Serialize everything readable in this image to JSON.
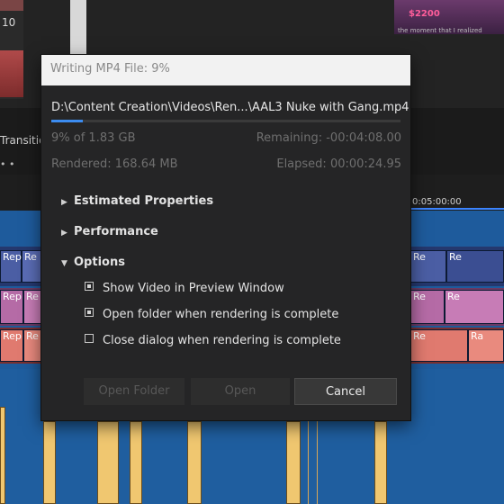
{
  "background": {
    "thumb_label": "10",
    "thumb_price": "$2200",
    "thumb_caption": "the moment that I realized",
    "transitions_label": "Transitio",
    "dots": "• •",
    "ruler_time": "0:05:00:00",
    "clip_labels": [
      "Rep",
      "Re",
      "Rep",
      "Re",
      "Rep",
      "Re",
      "Re",
      "Ra"
    ]
  },
  "dialog": {
    "title": "Writing MP4 File: 9%",
    "file_path": "D:\\Content Creation\\Videos\\Ren...\\AAL3 Nuke with Gang.mp4",
    "progress_percent": 9,
    "progress_text": "9% of 1.83 GB",
    "remaining_text": "Remaining: -00:04:08.00",
    "rendered_text": "Rendered: 168.64 MB",
    "elapsed_text": "Elapsed: 00:00:24.95",
    "sections": [
      {
        "label": "Estimated Properties",
        "expanded": false
      },
      {
        "label": "Performance",
        "expanded": false
      },
      {
        "label": "Options",
        "expanded": true
      }
    ],
    "options": [
      {
        "label": "Show Video in Preview Window",
        "checked": true
      },
      {
        "label": "Open folder when rendering is complete",
        "checked": true
      },
      {
        "label": "Close dialog when rendering is complete",
        "checked": false
      }
    ],
    "buttons": {
      "open_folder": "Open Folder",
      "open": "Open",
      "cancel": "Cancel"
    }
  },
  "colors": {
    "accent": "#3c8cf0",
    "timeline_blue": "#1e5b9c",
    "audio_clip": "#f0c770"
  }
}
